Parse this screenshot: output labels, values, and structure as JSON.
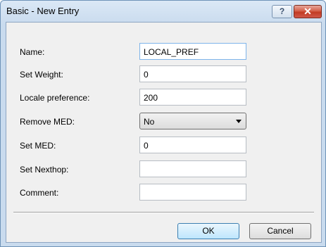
{
  "window": {
    "title": "Basic - New Entry",
    "help_glyph": "?",
    "close_glyph": "✕"
  },
  "form": {
    "name": {
      "label": "Name:",
      "value": "LOCAL_PREF"
    },
    "set_weight": {
      "label": "Set Weight:",
      "value": "0"
    },
    "locale_preference": {
      "label": "Locale preference:",
      "value": "200"
    },
    "remove_med": {
      "label": "Remove MED:",
      "value": "No"
    },
    "set_med": {
      "label": "Set MED:",
      "value": "0"
    },
    "set_nexthop": {
      "label": "Set Nexthop:",
      "value": ""
    },
    "comment": {
      "label": "Comment:",
      "value": ""
    }
  },
  "buttons": {
    "ok": "OK",
    "cancel": "Cancel"
  }
}
